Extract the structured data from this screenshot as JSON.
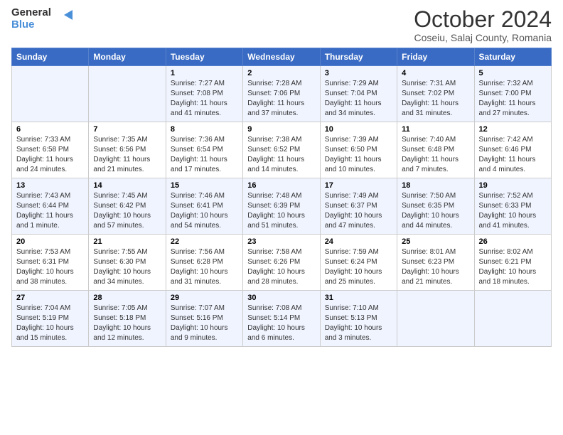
{
  "header": {
    "logo_line1": "General",
    "logo_line2": "Blue",
    "month": "October 2024",
    "location": "Coseiu, Salaj County, Romania"
  },
  "days_of_week": [
    "Sunday",
    "Monday",
    "Tuesday",
    "Wednesday",
    "Thursday",
    "Friday",
    "Saturday"
  ],
  "weeks": [
    [
      {
        "day": "",
        "info": ""
      },
      {
        "day": "",
        "info": ""
      },
      {
        "day": "1",
        "info": "Sunrise: 7:27 AM\nSunset: 7:08 PM\nDaylight: 11 hours and 41 minutes."
      },
      {
        "day": "2",
        "info": "Sunrise: 7:28 AM\nSunset: 7:06 PM\nDaylight: 11 hours and 37 minutes."
      },
      {
        "day": "3",
        "info": "Sunrise: 7:29 AM\nSunset: 7:04 PM\nDaylight: 11 hours and 34 minutes."
      },
      {
        "day": "4",
        "info": "Sunrise: 7:31 AM\nSunset: 7:02 PM\nDaylight: 11 hours and 31 minutes."
      },
      {
        "day": "5",
        "info": "Sunrise: 7:32 AM\nSunset: 7:00 PM\nDaylight: 11 hours and 27 minutes."
      }
    ],
    [
      {
        "day": "6",
        "info": "Sunrise: 7:33 AM\nSunset: 6:58 PM\nDaylight: 11 hours and 24 minutes."
      },
      {
        "day": "7",
        "info": "Sunrise: 7:35 AM\nSunset: 6:56 PM\nDaylight: 11 hours and 21 minutes."
      },
      {
        "day": "8",
        "info": "Sunrise: 7:36 AM\nSunset: 6:54 PM\nDaylight: 11 hours and 17 minutes."
      },
      {
        "day": "9",
        "info": "Sunrise: 7:38 AM\nSunset: 6:52 PM\nDaylight: 11 hours and 14 minutes."
      },
      {
        "day": "10",
        "info": "Sunrise: 7:39 AM\nSunset: 6:50 PM\nDaylight: 11 hours and 10 minutes."
      },
      {
        "day": "11",
        "info": "Sunrise: 7:40 AM\nSunset: 6:48 PM\nDaylight: 11 hours and 7 minutes."
      },
      {
        "day": "12",
        "info": "Sunrise: 7:42 AM\nSunset: 6:46 PM\nDaylight: 11 hours and 4 minutes."
      }
    ],
    [
      {
        "day": "13",
        "info": "Sunrise: 7:43 AM\nSunset: 6:44 PM\nDaylight: 11 hours and 1 minute."
      },
      {
        "day": "14",
        "info": "Sunrise: 7:45 AM\nSunset: 6:42 PM\nDaylight: 10 hours and 57 minutes."
      },
      {
        "day": "15",
        "info": "Sunrise: 7:46 AM\nSunset: 6:41 PM\nDaylight: 10 hours and 54 minutes."
      },
      {
        "day": "16",
        "info": "Sunrise: 7:48 AM\nSunset: 6:39 PM\nDaylight: 10 hours and 51 minutes."
      },
      {
        "day": "17",
        "info": "Sunrise: 7:49 AM\nSunset: 6:37 PM\nDaylight: 10 hours and 47 minutes."
      },
      {
        "day": "18",
        "info": "Sunrise: 7:50 AM\nSunset: 6:35 PM\nDaylight: 10 hours and 44 minutes."
      },
      {
        "day": "19",
        "info": "Sunrise: 7:52 AM\nSunset: 6:33 PM\nDaylight: 10 hours and 41 minutes."
      }
    ],
    [
      {
        "day": "20",
        "info": "Sunrise: 7:53 AM\nSunset: 6:31 PM\nDaylight: 10 hours and 38 minutes."
      },
      {
        "day": "21",
        "info": "Sunrise: 7:55 AM\nSunset: 6:30 PM\nDaylight: 10 hours and 34 minutes."
      },
      {
        "day": "22",
        "info": "Sunrise: 7:56 AM\nSunset: 6:28 PM\nDaylight: 10 hours and 31 minutes."
      },
      {
        "day": "23",
        "info": "Sunrise: 7:58 AM\nSunset: 6:26 PM\nDaylight: 10 hours and 28 minutes."
      },
      {
        "day": "24",
        "info": "Sunrise: 7:59 AM\nSunset: 6:24 PM\nDaylight: 10 hours and 25 minutes."
      },
      {
        "day": "25",
        "info": "Sunrise: 8:01 AM\nSunset: 6:23 PM\nDaylight: 10 hours and 21 minutes."
      },
      {
        "day": "26",
        "info": "Sunrise: 8:02 AM\nSunset: 6:21 PM\nDaylight: 10 hours and 18 minutes."
      }
    ],
    [
      {
        "day": "27",
        "info": "Sunrise: 7:04 AM\nSunset: 5:19 PM\nDaylight: 10 hours and 15 minutes."
      },
      {
        "day": "28",
        "info": "Sunrise: 7:05 AM\nSunset: 5:18 PM\nDaylight: 10 hours and 12 minutes."
      },
      {
        "day": "29",
        "info": "Sunrise: 7:07 AM\nSunset: 5:16 PM\nDaylight: 10 hours and 9 minutes."
      },
      {
        "day": "30",
        "info": "Sunrise: 7:08 AM\nSunset: 5:14 PM\nDaylight: 10 hours and 6 minutes."
      },
      {
        "day": "31",
        "info": "Sunrise: 7:10 AM\nSunset: 5:13 PM\nDaylight: 10 hours and 3 minutes."
      },
      {
        "day": "",
        "info": ""
      },
      {
        "day": "",
        "info": ""
      }
    ]
  ]
}
